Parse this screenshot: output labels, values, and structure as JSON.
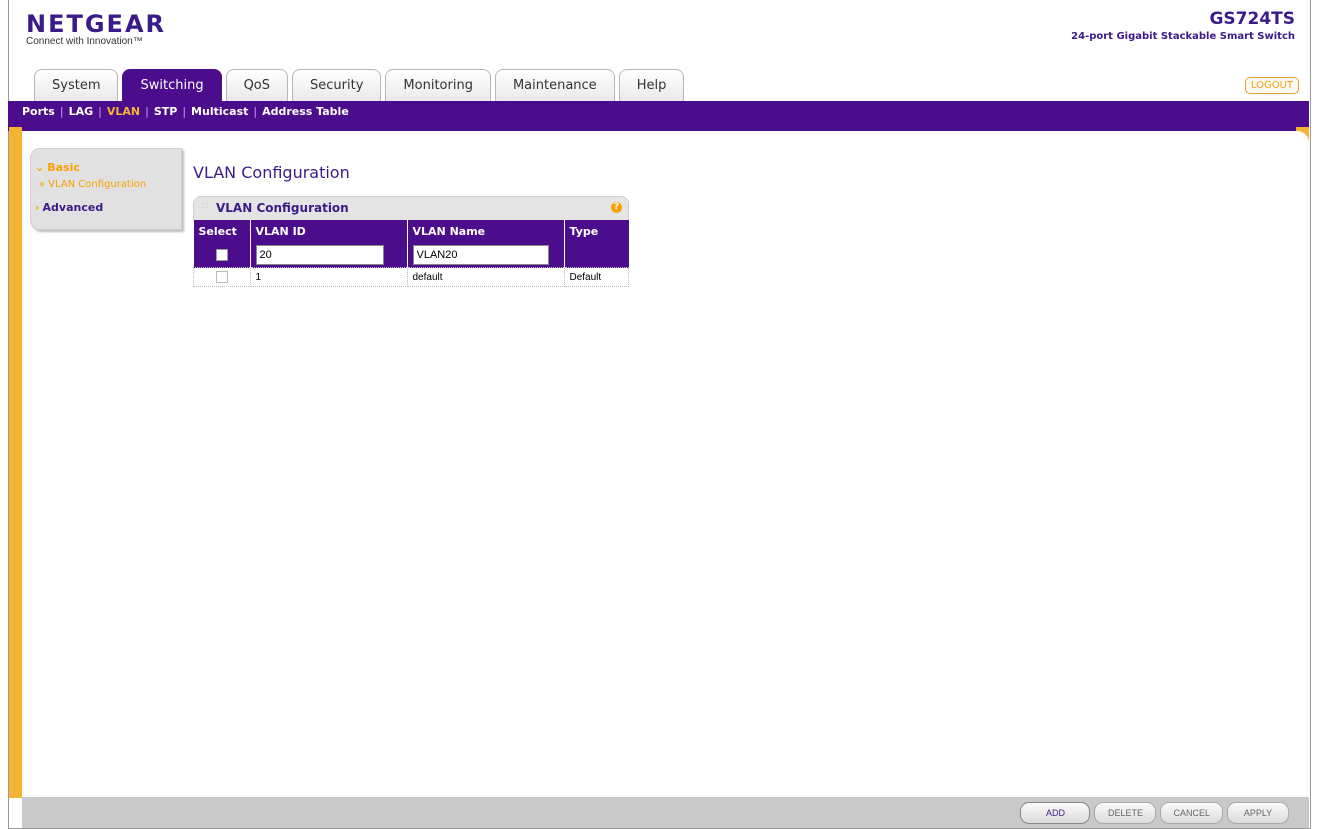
{
  "header": {
    "brand": "NETGEAR",
    "tagline": "Connect with Innovation",
    "model": "GS724TS",
    "model_desc": "24-port Gigabit Stackable Smart Switch",
    "logout": "LOGOUT"
  },
  "tabs": [
    {
      "label": "System"
    },
    {
      "label": "Switching"
    },
    {
      "label": "QoS"
    },
    {
      "label": "Security"
    },
    {
      "label": "Monitoring"
    },
    {
      "label": "Maintenance"
    },
    {
      "label": "Help"
    }
  ],
  "active_tab": "Switching",
  "subnav": [
    {
      "label": "Ports"
    },
    {
      "label": "LAG"
    },
    {
      "label": "VLAN"
    },
    {
      "label": "STP"
    },
    {
      "label": "Multicast"
    },
    {
      "label": "Address Table"
    }
  ],
  "active_subnav": "VLAN",
  "leftnav": {
    "basic": "Basic",
    "basic_sub": "VLAN Configuration",
    "advanced": "Advanced"
  },
  "main": {
    "title": "VLAN Configuration",
    "panel_title": "VLAN Configuration",
    "help": "?",
    "columns": [
      "Select",
      "VLAN ID",
      "VLAN Name",
      "Type"
    ],
    "edit_row": {
      "vlan_id": "20",
      "vlan_name": "VLAN20",
      "type": ""
    },
    "rows": [
      {
        "vlan_id": "1",
        "vlan_name": "default",
        "type": "Default"
      }
    ]
  },
  "footer": {
    "add": "ADD",
    "delete": "DELETE",
    "cancel": "CANCEL",
    "apply": "APPLY"
  },
  "colors": {
    "brand_purple": "#4b0d8c",
    "accent_orange": "#f5b333"
  }
}
